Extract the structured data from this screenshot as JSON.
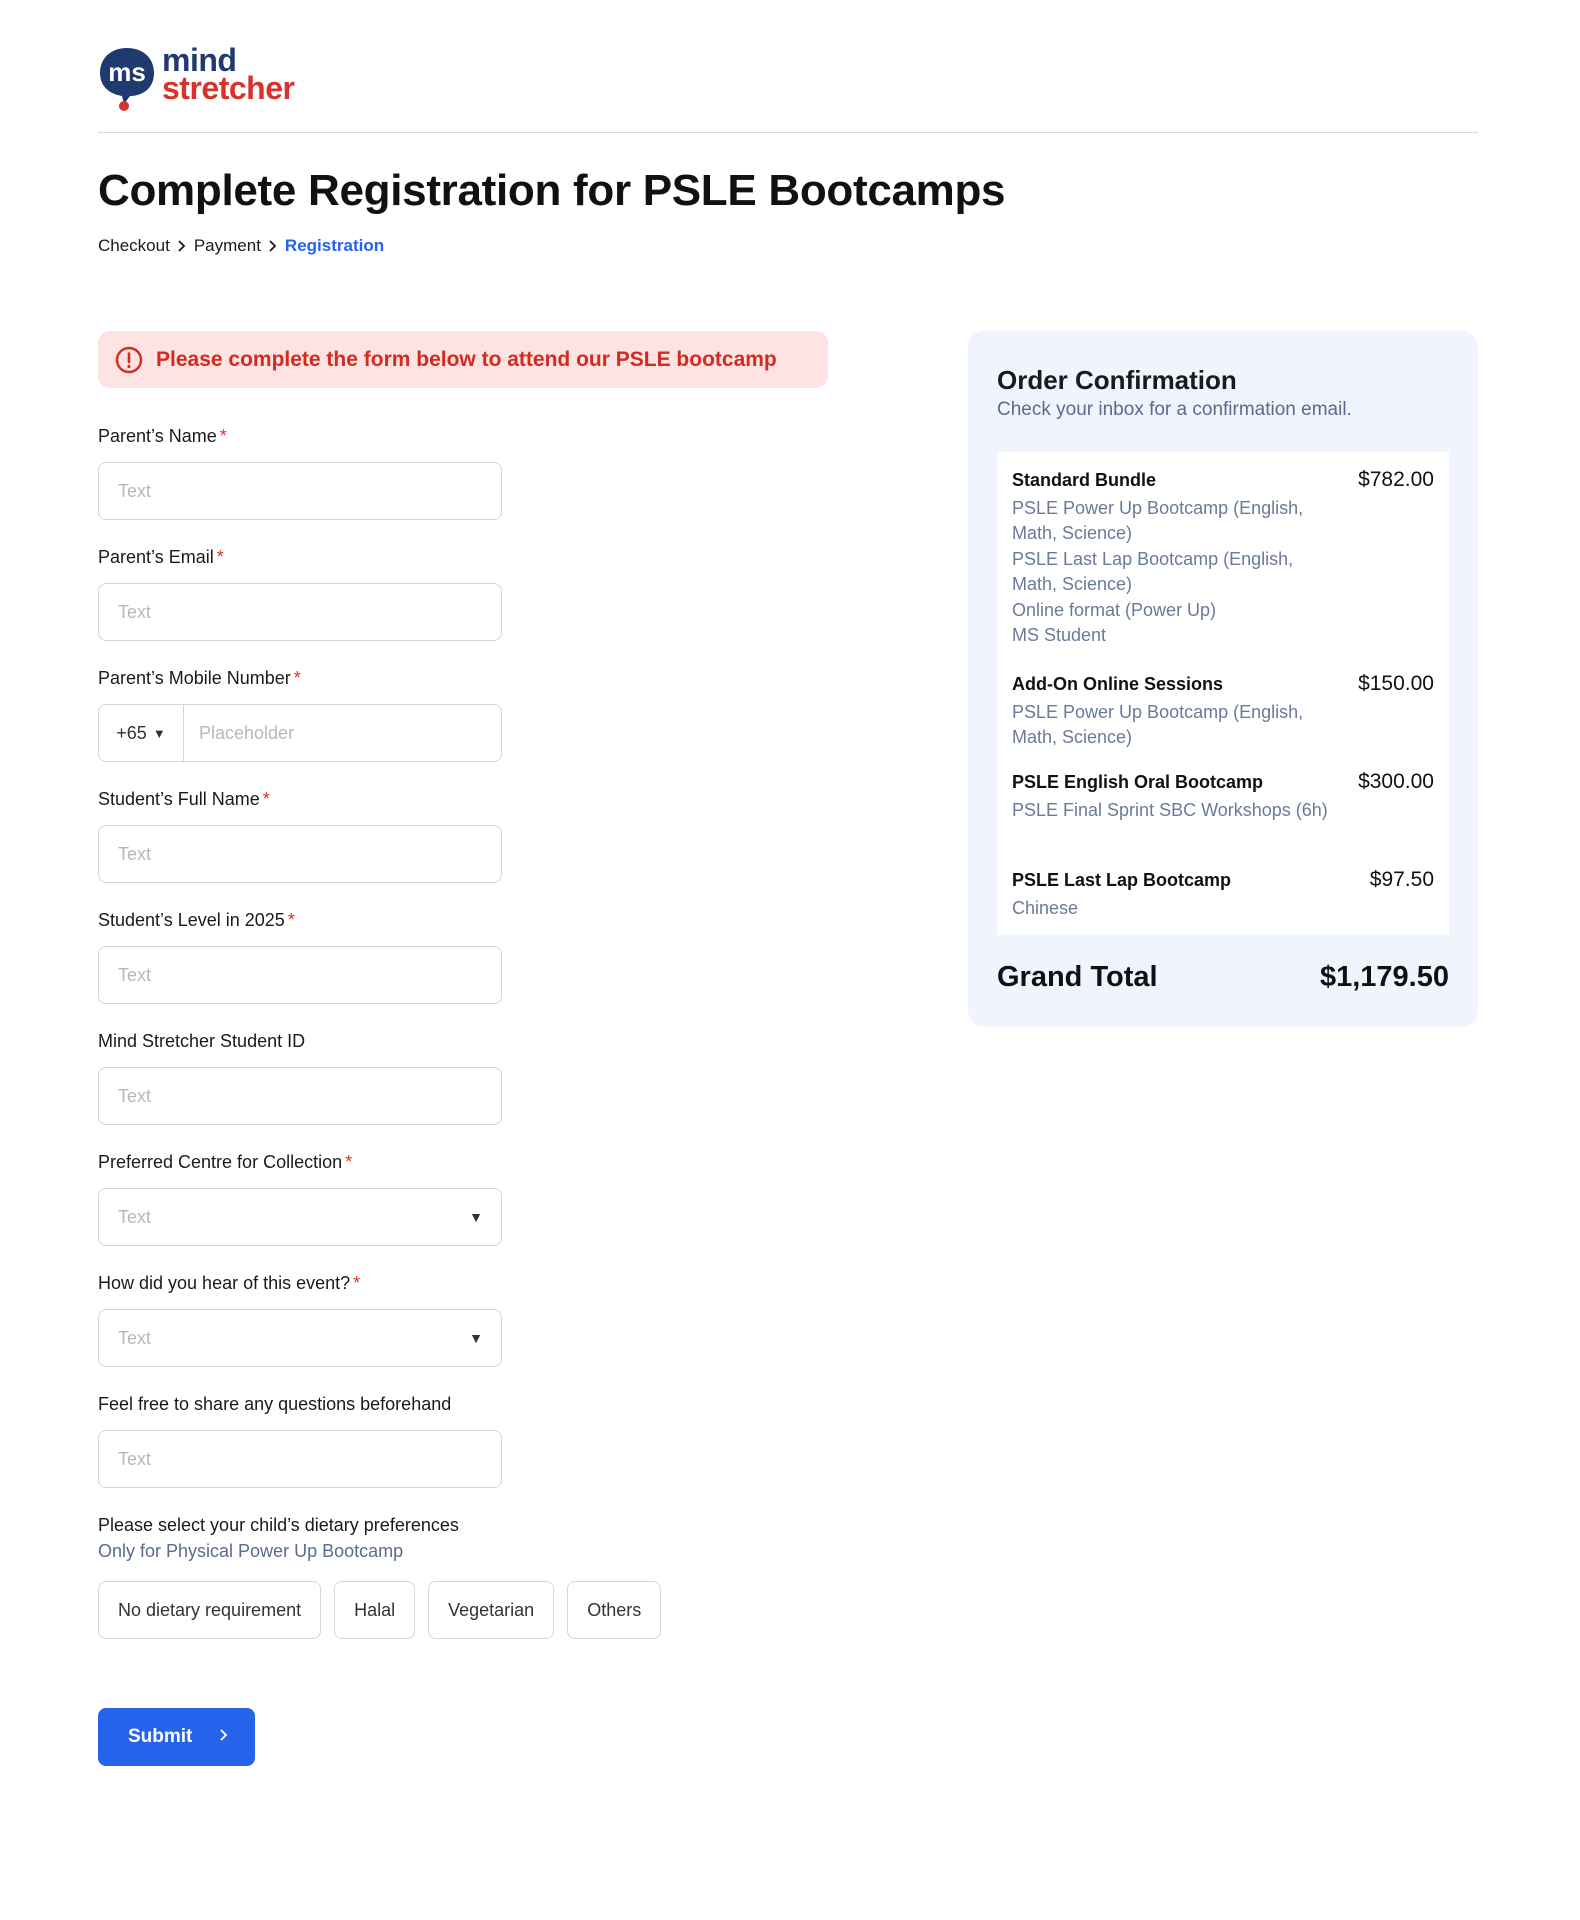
{
  "brand": {
    "line1": "mind",
    "line2": "stretcher",
    "mark": "ms"
  },
  "page": {
    "title": "Complete Registration for PSLE Bootcamps"
  },
  "breadcrumb": [
    {
      "label": "Checkout"
    },
    {
      "label": "Payment"
    },
    {
      "label": "Registration"
    }
  ],
  "alert": {
    "text": "Please complete the form below to attend our PSLE bootcamp",
    "icon": "alert-circle-icon"
  },
  "form": {
    "parent_name": {
      "label": "Parent’s Name",
      "placeholder": "Text",
      "required": "*"
    },
    "parent_email": {
      "label": "Parent’s Email",
      "placeholder": "Text",
      "required": "*"
    },
    "parent_mobile": {
      "label": "Parent’s Mobile Number",
      "code": "+65",
      "placeholder": "Placeholder",
      "required": "*"
    },
    "student_name": {
      "label": "Student’s Full Name",
      "placeholder": "Text",
      "required": "*"
    },
    "student_level": {
      "label": "Student’s Level in 2025",
      "placeholder": "Text",
      "required": "*"
    },
    "student_id": {
      "label": "Mind Stretcher Student ID",
      "placeholder": "Text"
    },
    "centre": {
      "label": "Preferred Centre for Collection",
      "placeholder": "Text",
      "required": "*"
    },
    "heard": {
      "label": "How did you hear of this event?",
      "placeholder": "Text",
      "required": "*"
    },
    "questions": {
      "label": "Feel free to share any questions beforehand",
      "placeholder": "Text"
    },
    "dietary": {
      "label": "Please select your child’s dietary preferences",
      "sublabel": "Only for Physical Power Up Bootcamp",
      "options": [
        "No dietary requirement",
        "Halal",
        "Vegetarian",
        "Others"
      ]
    },
    "submit_label": "Submit"
  },
  "order": {
    "title": "Order Confirmation",
    "subtitle": "Check your inbox for a confirmation email.",
    "items": [
      {
        "name": "Standard Bundle",
        "price": "$782.00",
        "details": [
          "PSLE Power Up Bootcamp (English, Math, Science)",
          "PSLE Last Lap Bootcamp (English, Math, Science)",
          "Online format (Power Up)",
          "MS Student"
        ]
      },
      {
        "name": "Add-On Online Sessions",
        "price": "$150.00",
        "details": [
          "PSLE Power Up Bootcamp (English, Math, Science)"
        ]
      },
      {
        "name": "PSLE English Oral Bootcamp",
        "price": "$300.00",
        "details": [
          "PSLE Final Sprint SBC Workshops (6h)"
        ]
      },
      {
        "name": "PSLE Last Lap Bootcamp",
        "price": "$97.50",
        "details": [
          "Chinese"
        ]
      }
    ],
    "grand_total_label": "Grand Total",
    "grand_total_value": "$1,179.50"
  },
  "colors": {
    "accent": "#2563eb",
    "alert_bg": "#fde3e1",
    "alert_text": "#d42b21",
    "brand_navy": "#1f3a6e",
    "brand_red": "#d6342b",
    "panel_bg": "#eff4fd"
  }
}
